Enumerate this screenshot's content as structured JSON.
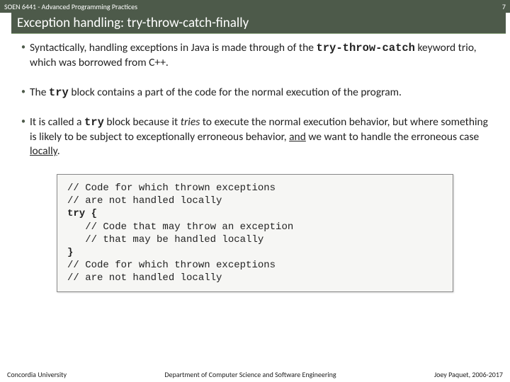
{
  "header": {
    "course": "SOEN 6441 - Advanced Programming Practices",
    "page": "7",
    "title": "Exception handling: try-throw-catch-finally"
  },
  "bullets": {
    "b1a": "Syntactically, handling exceptions in Java is made through of the ",
    "b1k": "try-throw-catch",
    "b1b": " keyword trio, which was borrowed from C++.",
    "b2a": "The ",
    "b2k": "try",
    "b2b": " block contains a part of the code for the normal execution of the program.",
    "b3a": "It is called a ",
    "b3k": "try",
    "b3b": " block because it ",
    "b3i": "tries",
    "b3c": " to execute the normal execution behavior, but where something is likely to be subject to exceptionally erroneous behavior, ",
    "b3u": "and",
    "b3d": " we want to handle the erroneous case ",
    "b3u2": "locally",
    "b3e": "."
  },
  "code": {
    "l1": "// Code for which thrown exceptions",
    "l2": "// are not handled locally",
    "l3a": "try {",
    "l4": "   // Code that may throw an exception",
    "l5": "   // that may be handled locally",
    "l6a": "}",
    "l7": "// Code for which thrown exceptions",
    "l8": "// are not handled locally"
  },
  "footer": {
    "left": "Concordia University",
    "center": "Department of Computer Science and Software Engineering",
    "right": "Joey Paquet, 2006-2017"
  }
}
